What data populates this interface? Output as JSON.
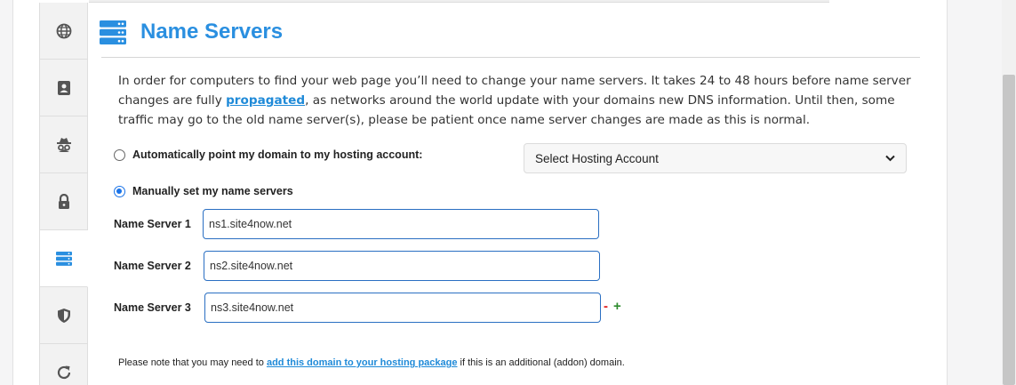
{
  "section": {
    "title": "Name Servers",
    "icon": "server-stack-icon",
    "accent_color": "#2a8fe0"
  },
  "intro": {
    "text_before": "In order for computers to find your web page you’ll need to change your name servers. It takes 24 to 48 hours before name server changes are fully ",
    "link_text": "propagated",
    "text_after": ", as networks around the world update with your domains new DNS information. Until then, some traffic may go to the old name server(s), please be patient once name server changes are made as this is normal."
  },
  "sidebar": {
    "tabs": [
      {
        "icon": "globe-icon",
        "active": false
      },
      {
        "icon": "contact-card-icon",
        "active": false
      },
      {
        "icon": "incognito-icon",
        "active": false
      },
      {
        "icon": "lock-icon",
        "active": false
      },
      {
        "icon": "server-stack-icon",
        "active": true
      },
      {
        "icon": "shield-icon",
        "active": false
      },
      {
        "icon": "refresh-icon",
        "active": false
      }
    ]
  },
  "options": {
    "auto_label": "Automatically point my domain to my hosting account:",
    "auto_checked": false,
    "manual_label": "Manually set my name servers",
    "manual_checked": true,
    "hosting_select": "Select Hosting Account"
  },
  "nameservers": [
    {
      "label": "Name Server 1",
      "value": "ns1.site4now.net"
    },
    {
      "label": "Name Server 2",
      "value": "ns2.site4now.net"
    },
    {
      "label": "Name Server 3",
      "value": "ns3.site4now.net"
    }
  ],
  "controls": {
    "remove": "-",
    "add": "+"
  },
  "note": {
    "text_before": "Please note that you may need to ",
    "link_text": "add this domain to your hosting package",
    "text_after": " if this is an additional (addon) domain."
  }
}
